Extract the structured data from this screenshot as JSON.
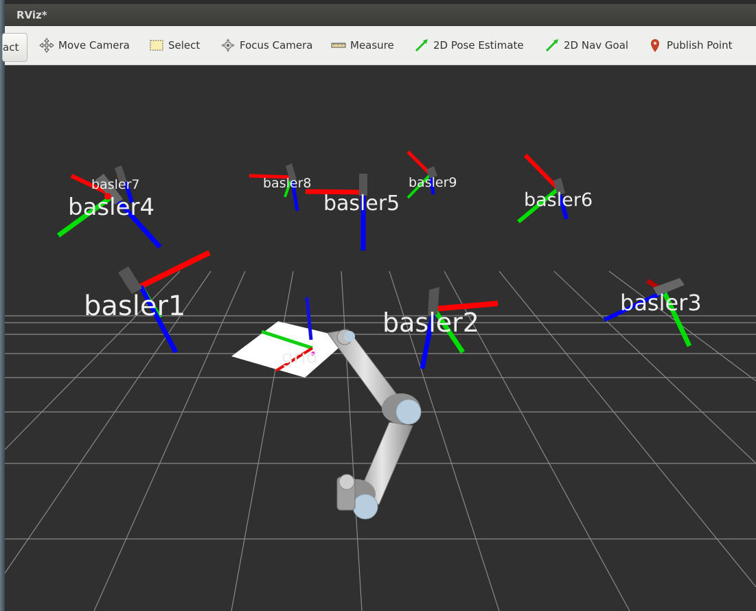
{
  "window": {
    "title": "RViz*"
  },
  "toolbar": {
    "interact": "act",
    "move_camera": "Move Camera",
    "select": "Select",
    "focus_camera": "Focus Camera",
    "measure": "Measure",
    "pose_estimate": "2D Pose Estimate",
    "nav_goal": "2D Nav Goal",
    "publish_point": "Publish Point"
  },
  "scene": {
    "frames": {
      "basler1": "basler1",
      "basler2": "basler2",
      "basler3": "basler3",
      "basler4": "basler4",
      "basler5": "basler5",
      "basler6": "basler6",
      "basler7": "basler7",
      "basler8": "basler8",
      "basler9": "basler9",
      "grid": "grid"
    },
    "colors": {
      "x_axis": "#ff0000",
      "y_axis": "#00e000",
      "z_axis": "#0000ff",
      "background": "#303030",
      "grid_lines": "#a0a0a0"
    }
  }
}
